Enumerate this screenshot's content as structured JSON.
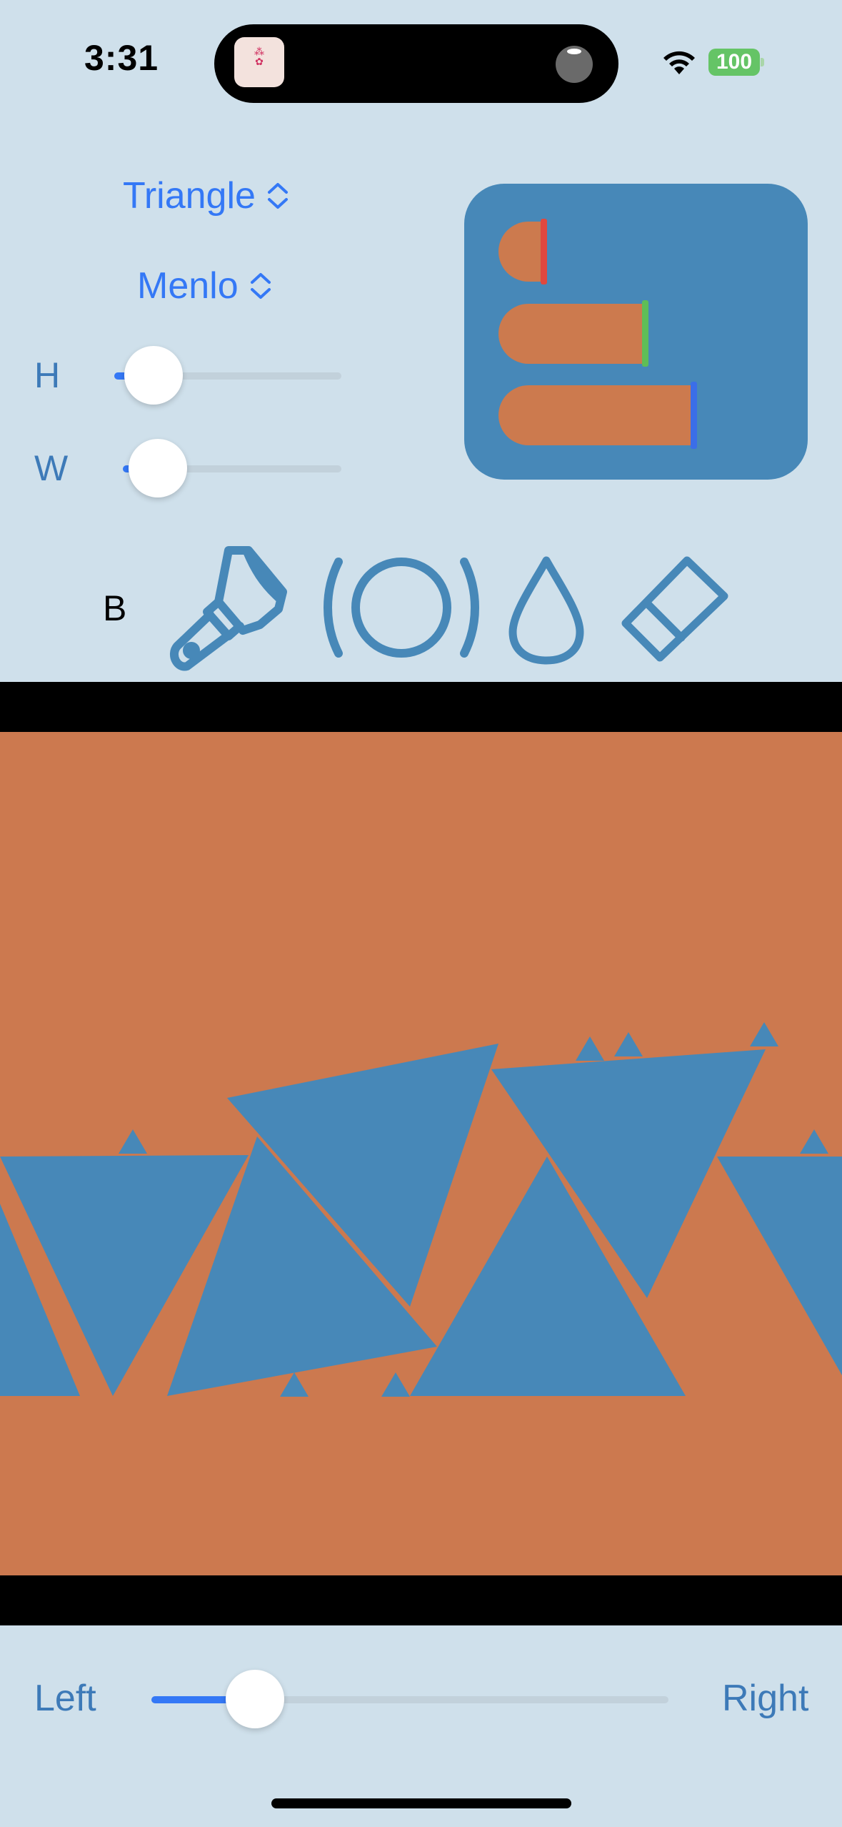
{
  "status_bar": {
    "time": "3:31",
    "battery": "100",
    "island_app_icon": "app-thumbnail"
  },
  "controls": {
    "shape_picker": "Triangle",
    "font_picker": "Menlo",
    "height_label": "H",
    "height_value": 0.12,
    "width_label": "W",
    "width_value": 0.1,
    "tool_b_label": "B",
    "tools": [
      "paintbrush-icon",
      "circle-waves-icon",
      "drop-icon",
      "eraser-icon"
    ]
  },
  "preview": {
    "bars": [
      {
        "level": 0.2,
        "cap_color": "#e0483e"
      },
      {
        "level": 0.65,
        "cap_color": "#5fbe57"
      },
      {
        "level": 0.85,
        "cap_color": "#3b6ee8"
      }
    ]
  },
  "canvas": {
    "background": "#cc794f",
    "shape_color": "#4788b8"
  },
  "bottom": {
    "left_label": "Left",
    "right_label": "Right",
    "slider_value": 0.2
  },
  "colors": {
    "accent": "#3478f6",
    "background": "#cfe0eb"
  }
}
